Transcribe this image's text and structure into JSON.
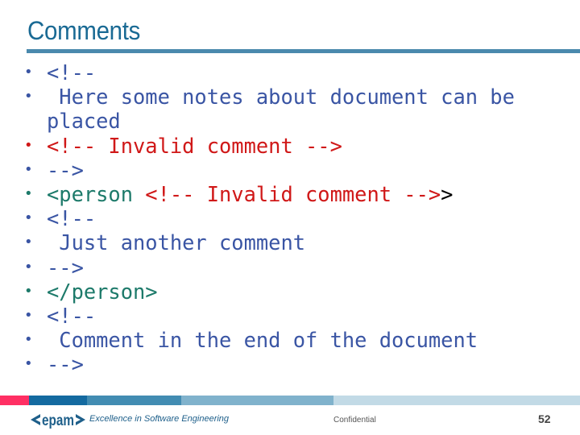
{
  "slide": {
    "title": "Comments",
    "colors": {
      "title": "#1a6a94",
      "comment": "#3a55a4",
      "invalid": "#d01818",
      "tag": "#1d7a6a",
      "plain": "#000000",
      "footer_segments": [
        "#ff2f63",
        "#146aa0",
        "#428cb2",
        "#80b2cc",
        "#c2dae6"
      ]
    },
    "lines": [
      {
        "bullet_color": "#3a55a4",
        "segments": [
          {
            "text": "<!--",
            "color": "#3a55a4"
          }
        ]
      },
      {
        "bullet_color": "#3a55a4",
        "segments": [
          {
            "text": " Here some notes about document can be",
            "color": "#3a55a4"
          }
        ]
      },
      {
        "bullet_color": null,
        "segments": [
          {
            "text": "placed",
            "color": "#3a55a4"
          }
        ]
      },
      {
        "bullet_color": "#d01818",
        "segments": [
          {
            "text": "<!-- Invalid comment -->",
            "color": "#d01818"
          }
        ]
      },
      {
        "bullet_color": "#3a55a4",
        "segments": [
          {
            "text": "-->",
            "color": "#3a55a4"
          }
        ]
      },
      {
        "bullet_color": "#1d7a6a",
        "segments": [
          {
            "text": "<person ",
            "color": "#1d7a6a"
          },
          {
            "text": "<!-- Invalid comment -->",
            "color": "#d01818"
          },
          {
            "text": ">",
            "color": "#000000"
          }
        ]
      },
      {
        "bullet_color": "#3a55a4",
        "segments": [
          {
            "text": "<!--",
            "color": "#3a55a4"
          }
        ]
      },
      {
        "bullet_color": "#3a55a4",
        "segments": [
          {
            "text": " Just another comment",
            "color": "#3a55a4"
          }
        ]
      },
      {
        "bullet_color": "#3a55a4",
        "segments": [
          {
            "text": "-->",
            "color": "#3a55a4"
          }
        ]
      },
      {
        "bullet_color": "#1d7a6a",
        "segments": [
          {
            "text": "</person>",
            "color": "#1d7a6a"
          }
        ]
      },
      {
        "bullet_color": "#3a55a4",
        "segments": [
          {
            "text": "<!--",
            "color": "#3a55a4"
          }
        ]
      },
      {
        "bullet_color": "#3a55a4",
        "segments": [
          {
            "text": " Comment in the end of the document",
            "color": "#3a55a4"
          }
        ]
      },
      {
        "bullet_color": "#3a55a4",
        "segments": [
          {
            "text": "-->",
            "color": "#3a55a4"
          }
        ]
      }
    ],
    "bullet_glyph": "•"
  },
  "footer": {
    "logo_text": "<epam>",
    "tagline": "Excellence in Software Engineering",
    "confidential": "Confidential",
    "page_number": "52"
  }
}
